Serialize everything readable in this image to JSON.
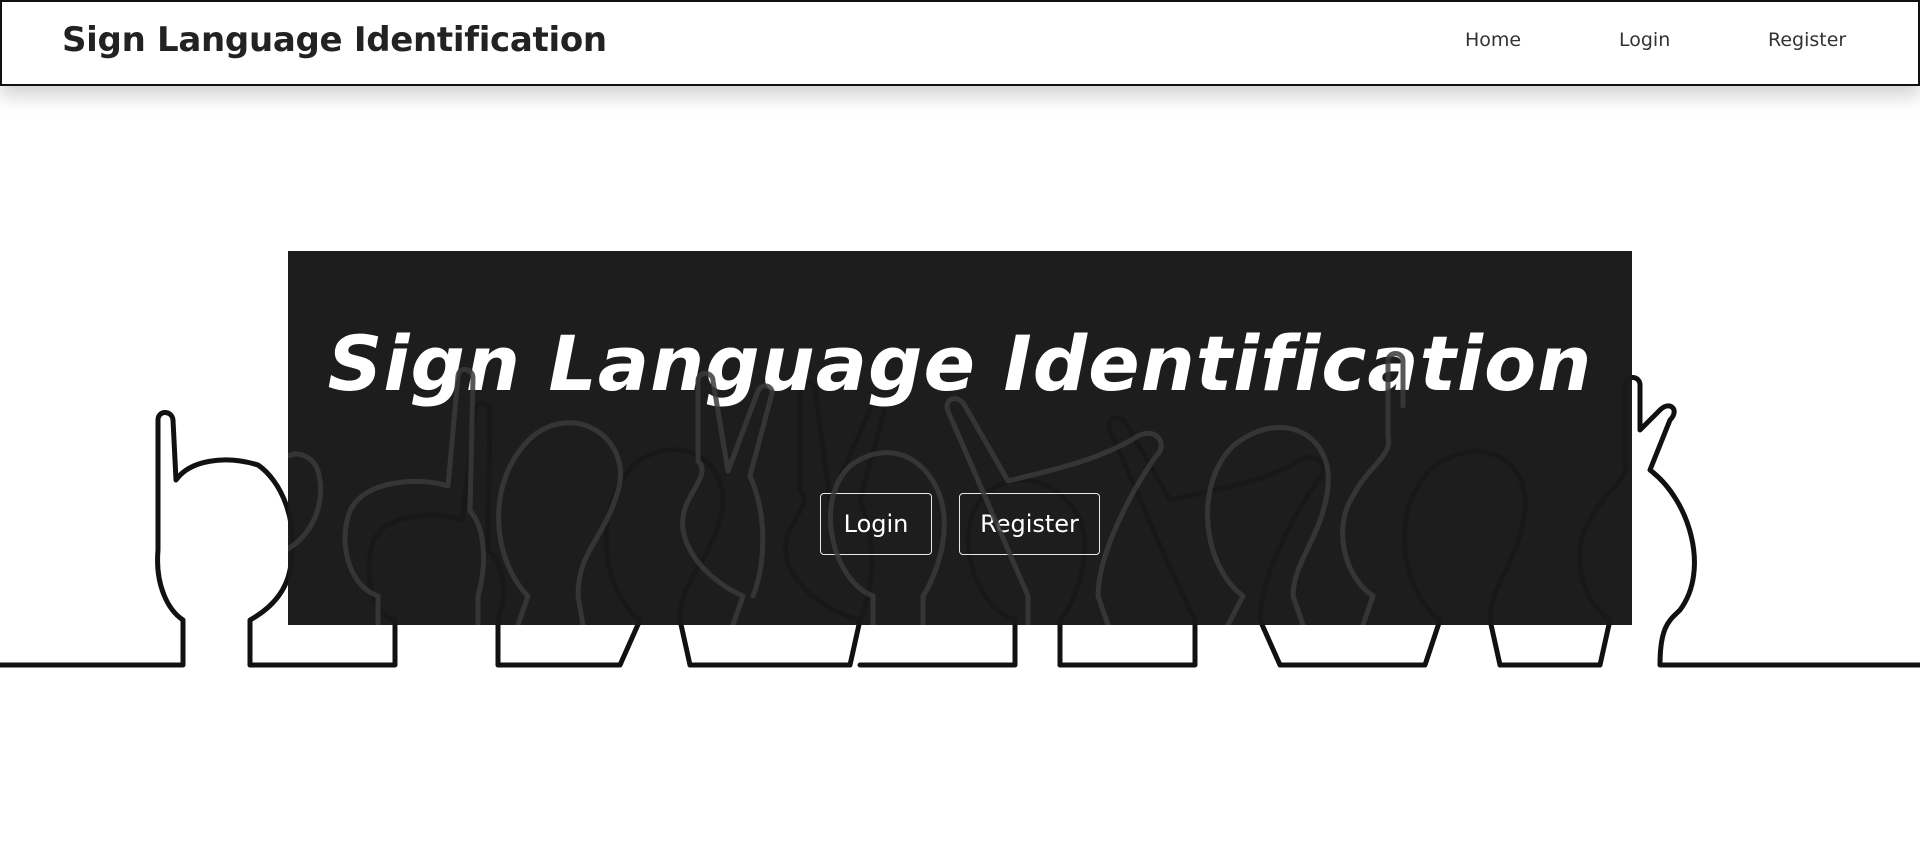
{
  "navbar": {
    "brand": "Sign Language Identification",
    "links": [
      "Home",
      "Login",
      "Register"
    ]
  },
  "hero": {
    "title": "Sign Language Identification",
    "buttons": [
      "Login",
      "Register"
    ]
  },
  "colors": {
    "hero_background": "#181818",
    "text_light": "#ffffff",
    "navbar_border": "#111111"
  }
}
